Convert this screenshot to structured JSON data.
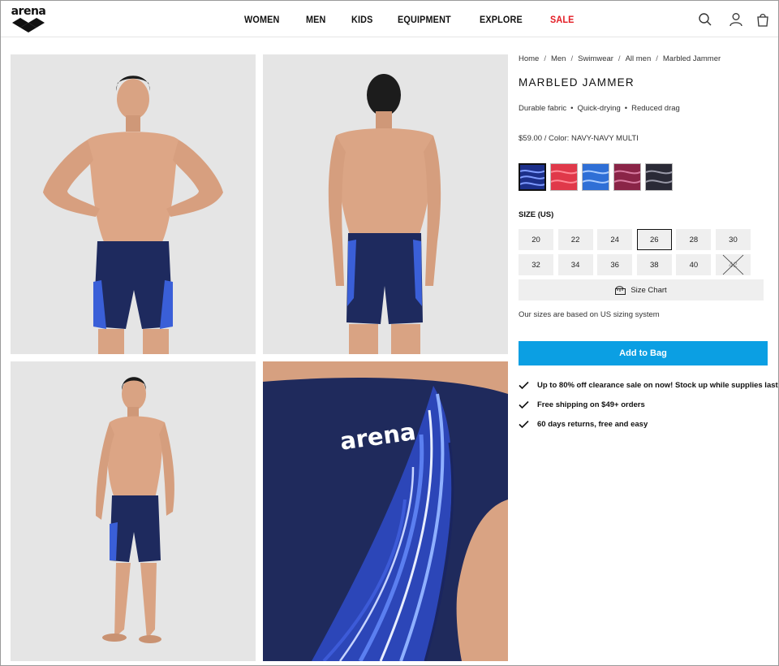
{
  "brand": {
    "logo_text": "arena"
  },
  "nav": {
    "items": [
      {
        "label": "WOMEN"
      },
      {
        "label": "MEN"
      },
      {
        "label": "KIDS"
      },
      {
        "label": "EQUIPMENT"
      },
      {
        "label": "EXPLORE"
      },
      {
        "label": "SALE"
      }
    ],
    "icons": [
      "search-icon",
      "account-icon",
      "bag-icon"
    ],
    "sale_color": "#e31b23"
  },
  "breadcrumb": [
    "Home",
    "Men",
    "Swimwear",
    "All men",
    "Marbled Jammer"
  ],
  "breadcrumb_separator": "/",
  "product": {
    "title": "MARBLED JAMMER",
    "features": [
      "Durable fabric",
      "Quick-drying",
      "Reduced drag"
    ],
    "feature_separator": "•",
    "price_line": "$59.00 / Color: NAVY-NAVY MULTI",
    "swatches": [
      {
        "color": "#1c2f8a",
        "selected": true
      },
      {
        "color": "#e0394a",
        "selected": false
      },
      {
        "color": "#2f6fd6",
        "selected": false
      },
      {
        "color": "#8a2447",
        "selected": false
      },
      {
        "color": "#2a2a36",
        "selected": false
      }
    ],
    "size_label": "SIZE (US)",
    "sizes": [
      {
        "label": "20"
      },
      {
        "label": "22"
      },
      {
        "label": "24"
      },
      {
        "label": "26",
        "selected": true
      },
      {
        "label": "28"
      },
      {
        "label": "30"
      },
      {
        "label": "32"
      },
      {
        "label": "34"
      },
      {
        "label": "36"
      },
      {
        "label": "38"
      },
      {
        "label": "40"
      },
      {
        "label": "42",
        "out_of_stock": true
      }
    ],
    "size_chart_label": "Size Chart",
    "size_note": "Our sizes are based on US sizing system",
    "add_to_bag": "Add to Bag",
    "cta_color": "#0b9fe3",
    "perks": [
      "Up to 80% off clearance sale on now! Stock up while supplies last",
      "Free shipping on $49+ orders",
      "60 days returns, free and easy"
    ]
  },
  "gallery": {
    "images": [
      "front-view-photo",
      "back-view-photo",
      "side-view-photo",
      "fabric-detail-photo"
    ],
    "detail_logo_text": "arena"
  }
}
